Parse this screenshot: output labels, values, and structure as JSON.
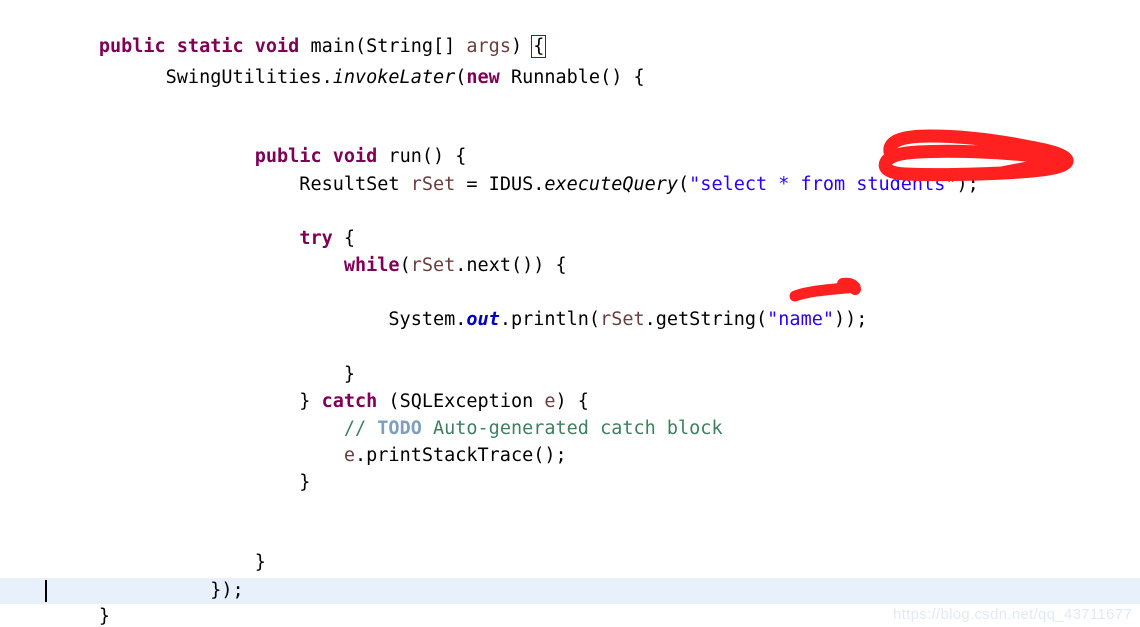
{
  "editor": {
    "language": "java",
    "background_color": "#FFFFFF",
    "current_line_highlight_color": "#E8F0FB",
    "syntax_colors": {
      "keyword": "#7F0055",
      "string": "#2A00FF",
      "comment": "#3F7F5F",
      "task_tag": "#7F9FBF",
      "local_variable": "#6A3E3E",
      "static_field": "#0000C0",
      "plain": "#000000",
      "matching_bracket_outline": "#7F0055"
    },
    "lines": [
      {
        "n": 1,
        "indent": 0,
        "text": "public static void main(String[] args) {"
      },
      {
        "n": 2,
        "indent": 6,
        "text": "SwingUtilities.invokeLater(new Runnable() {"
      },
      {
        "n": 3,
        "indent": 0,
        "text": ""
      },
      {
        "n": 4,
        "indent": 0,
        "text": ""
      },
      {
        "n": 5,
        "indent": 14,
        "text": "public void run() {"
      },
      {
        "n": 6,
        "indent": 18,
        "text": "ResultSet rSet = IDUS.executeQuery(\"select * from students\");"
      },
      {
        "n": 7,
        "indent": 0,
        "text": ""
      },
      {
        "n": 8,
        "indent": 18,
        "text": "try {"
      },
      {
        "n": 9,
        "indent": 22,
        "text": "while(rSet.next()) {"
      },
      {
        "n": 10,
        "indent": 0,
        "text": ""
      },
      {
        "n": 11,
        "indent": 26,
        "text": "System.out.println(rSet.getString(\"name\"));"
      },
      {
        "n": 12,
        "indent": 0,
        "text": ""
      },
      {
        "n": 13,
        "indent": 22,
        "text": "}"
      },
      {
        "n": 14,
        "indent": 18,
        "text": "} catch (SQLException e) {"
      },
      {
        "n": 15,
        "indent": 22,
        "text": "// TODO Auto-generated catch block"
      },
      {
        "n": 16,
        "indent": 22,
        "text": "e.printStackTrace();"
      },
      {
        "n": 17,
        "indent": 18,
        "text": "}"
      },
      {
        "n": 18,
        "indent": 0,
        "text": ""
      },
      {
        "n": 19,
        "indent": 0,
        "text": ""
      },
      {
        "n": 20,
        "indent": 14,
        "text": "}"
      },
      {
        "n": 21,
        "indent": 10,
        "text": "});"
      },
      {
        "n": 22,
        "indent": 0,
        "text": "}"
      }
    ]
  },
  "annotations": {
    "ink_color": "#FF2020",
    "marks": [
      {
        "name": "circle-students-table",
        "type": "ellipse-loop",
        "targets_text": "students\");"
      },
      {
        "name": "strikethrough-name-column",
        "type": "brush-stroke",
        "targets_text": "name"
      }
    ]
  },
  "watermark": {
    "text": "https://blog.csdn.net/qq_43711677"
  }
}
